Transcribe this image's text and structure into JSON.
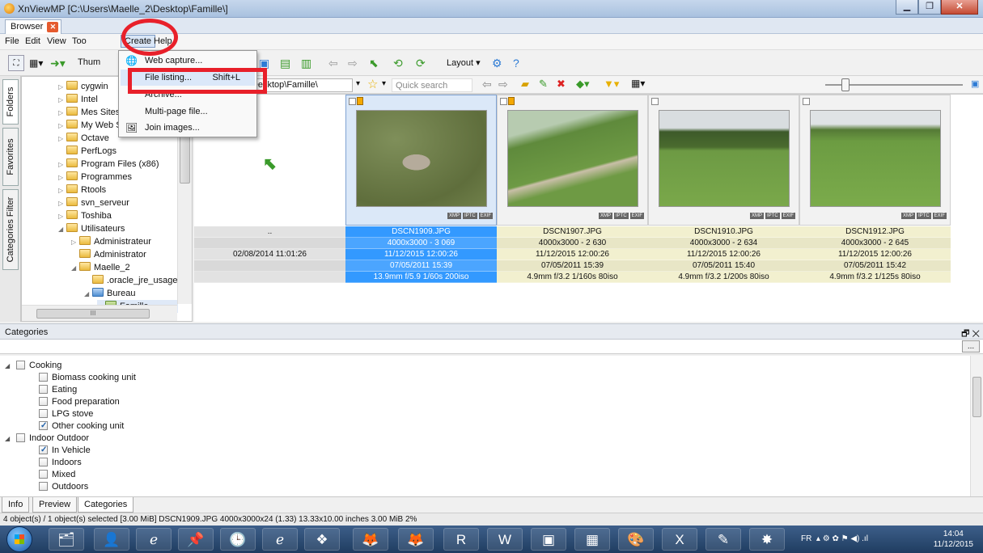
{
  "window": {
    "title": "XnViewMP [C:\\Users\\Maelle_2\\Desktop\\Famille\\]"
  },
  "doc_tab": {
    "label": "Browser"
  },
  "menu": {
    "file": "File",
    "edit": "Edit",
    "view": "View",
    "tools": "Too",
    "create": "Create",
    "help": "Help"
  },
  "toolbar": {
    "thumbs_label": "Thum",
    "layout_label": "Layout"
  },
  "dropdown": {
    "items": [
      {
        "label": "Web capture..."
      },
      {
        "label": "File listing...",
        "shortcut": "Shift+L"
      },
      {
        "label": "Archive..."
      },
      {
        "label": "Multi-page file..."
      },
      {
        "label": "Join images..."
      }
    ]
  },
  "left_tabs": {
    "folders": "Folders",
    "favorites": "Favorites",
    "categories_filter": "Categories Filter"
  },
  "tree": {
    "items": [
      {
        "label": "cygwin"
      },
      {
        "label": "Intel"
      },
      {
        "label": "Mes Sites"
      },
      {
        "label": "My Web S"
      },
      {
        "label": "Octave"
      },
      {
        "label": "PerfLogs"
      },
      {
        "label": "Program Files (x86)"
      },
      {
        "label": "Programmes"
      },
      {
        "label": "Rtools"
      },
      {
        "label": "svn_serveur"
      },
      {
        "label": "Toshiba"
      },
      {
        "label": "Utilisateurs"
      },
      {
        "label": "Administrateur"
      },
      {
        "label": "Administrator"
      },
      {
        "label": "Maelle_2"
      },
      {
        "label": ".oracle_jre_usage"
      },
      {
        "label": "Bureau"
      },
      {
        "label": "Famille"
      }
    ]
  },
  "address": {
    "path": "...\\Maelle_2\\Desktop\\Famille\\",
    "search_placeholder": "Quick search"
  },
  "parent_cell": {
    "name": "..",
    "date": "02/08/2014 11:01:26"
  },
  "thumbnails": [
    {
      "name": "DSCN1909.JPG",
      "dims": "4000x3000 - 3 069",
      "modified": "11/12/2015 12:00:26",
      "taken": "07/05/2011 15:39",
      "exif": "13.9mm f/5.9 1/60s 200iso"
    },
    {
      "name": "DSCN1907.JPG",
      "dims": "4000x3000 - 2 630",
      "modified": "11/12/2015 12:00:26",
      "taken": "07/05/2011 15:39",
      "exif": "4.9mm f/3.2 1/160s 80iso"
    },
    {
      "name": "DSCN1910.JPG",
      "dims": "4000x3000 - 2 634",
      "modified": "11/12/2015 12:00:26",
      "taken": "07/05/2011 15:40",
      "exif": "4.9mm f/3.2 1/200s 80iso"
    },
    {
      "name": "DSCN1912.JPG",
      "dims": "4000x3000 - 2 645",
      "modified": "11/12/2015 12:00:26",
      "taken": "07/05/2011 15:42",
      "exif": "4.9mm f/3.2 1/125s 80iso"
    }
  ],
  "badges": {
    "xmp": "XMP",
    "iptc": "IPTC",
    "exif": "EXIF"
  },
  "categories": {
    "header": "Categories",
    "items": [
      {
        "label": "Cooking",
        "checked": false,
        "group": true
      },
      {
        "label": "Biomass cooking unit",
        "checked": false
      },
      {
        "label": "Eating",
        "checked": false
      },
      {
        "label": "Food preparation",
        "checked": false
      },
      {
        "label": "LPG stove",
        "checked": false
      },
      {
        "label": "Other cooking unit",
        "checked": true
      },
      {
        "label": "Indoor Outdoor",
        "checked": false,
        "group": true
      },
      {
        "label": "In Vehicle",
        "checked": true
      },
      {
        "label": "Indoors",
        "checked": false
      },
      {
        "label": "Mixed",
        "checked": false
      },
      {
        "label": "Outdoors",
        "checked": false
      }
    ],
    "more_button": "..."
  },
  "bottom_tabs": {
    "info": "Info",
    "preview": "Preview",
    "categories": "Categories"
  },
  "status": {
    "text": "4 object(s) / 1 object(s) selected [3.00 MiB]  DSCN1909.JPG  4000x3000x24 (1.33)  13.33x10.00 inches  3.00 MiB  2%"
  },
  "taskbar": {
    "lang": "FR",
    "time": "14:04",
    "date": "11/12/2015"
  },
  "colors": {
    "annotation_red": "#e8202a",
    "selection_blue": "#3399ff",
    "info_yellow": "#f2f0cf"
  }
}
